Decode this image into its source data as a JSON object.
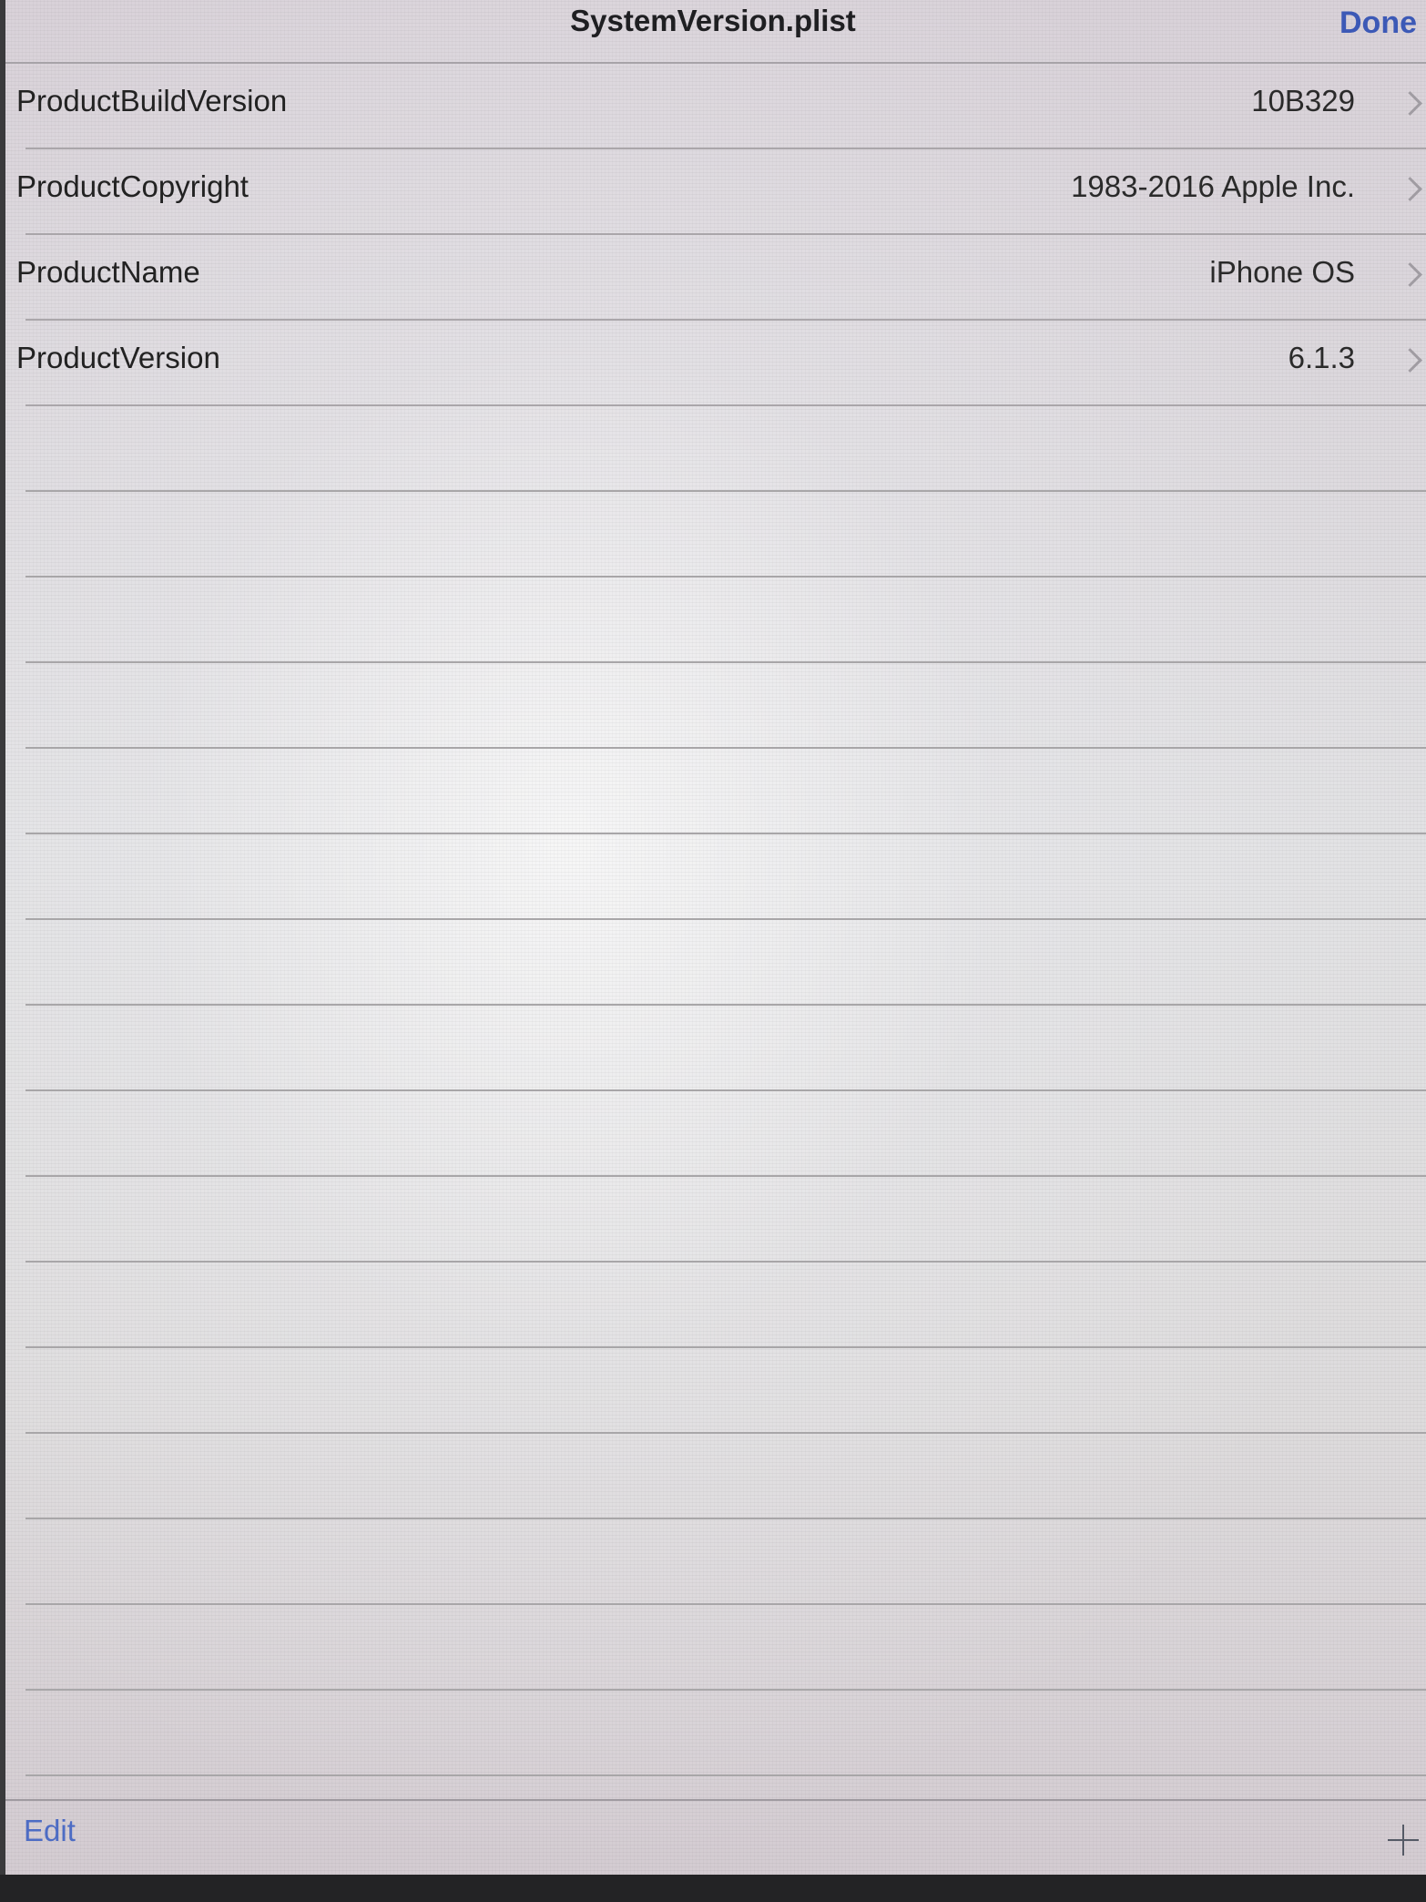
{
  "navbar": {
    "title": "SystemVersion.plist",
    "done_label": "Done"
  },
  "rows": [
    {
      "key": "ProductBuildVersion",
      "value": "10B329"
    },
    {
      "key": "ProductCopyright",
      "value": "1983-2016 Apple Inc."
    },
    {
      "key": "ProductName",
      "value": "iPhone OS"
    },
    {
      "key": "ProductVersion",
      "value": "6.1.3"
    }
  ],
  "toolbar": {
    "edit_label": "Edit",
    "add_icon": "plus-icon"
  },
  "colors": {
    "accent": "#3c59b6",
    "separator": "#aaa6aa",
    "background": "#e2e2e4"
  }
}
